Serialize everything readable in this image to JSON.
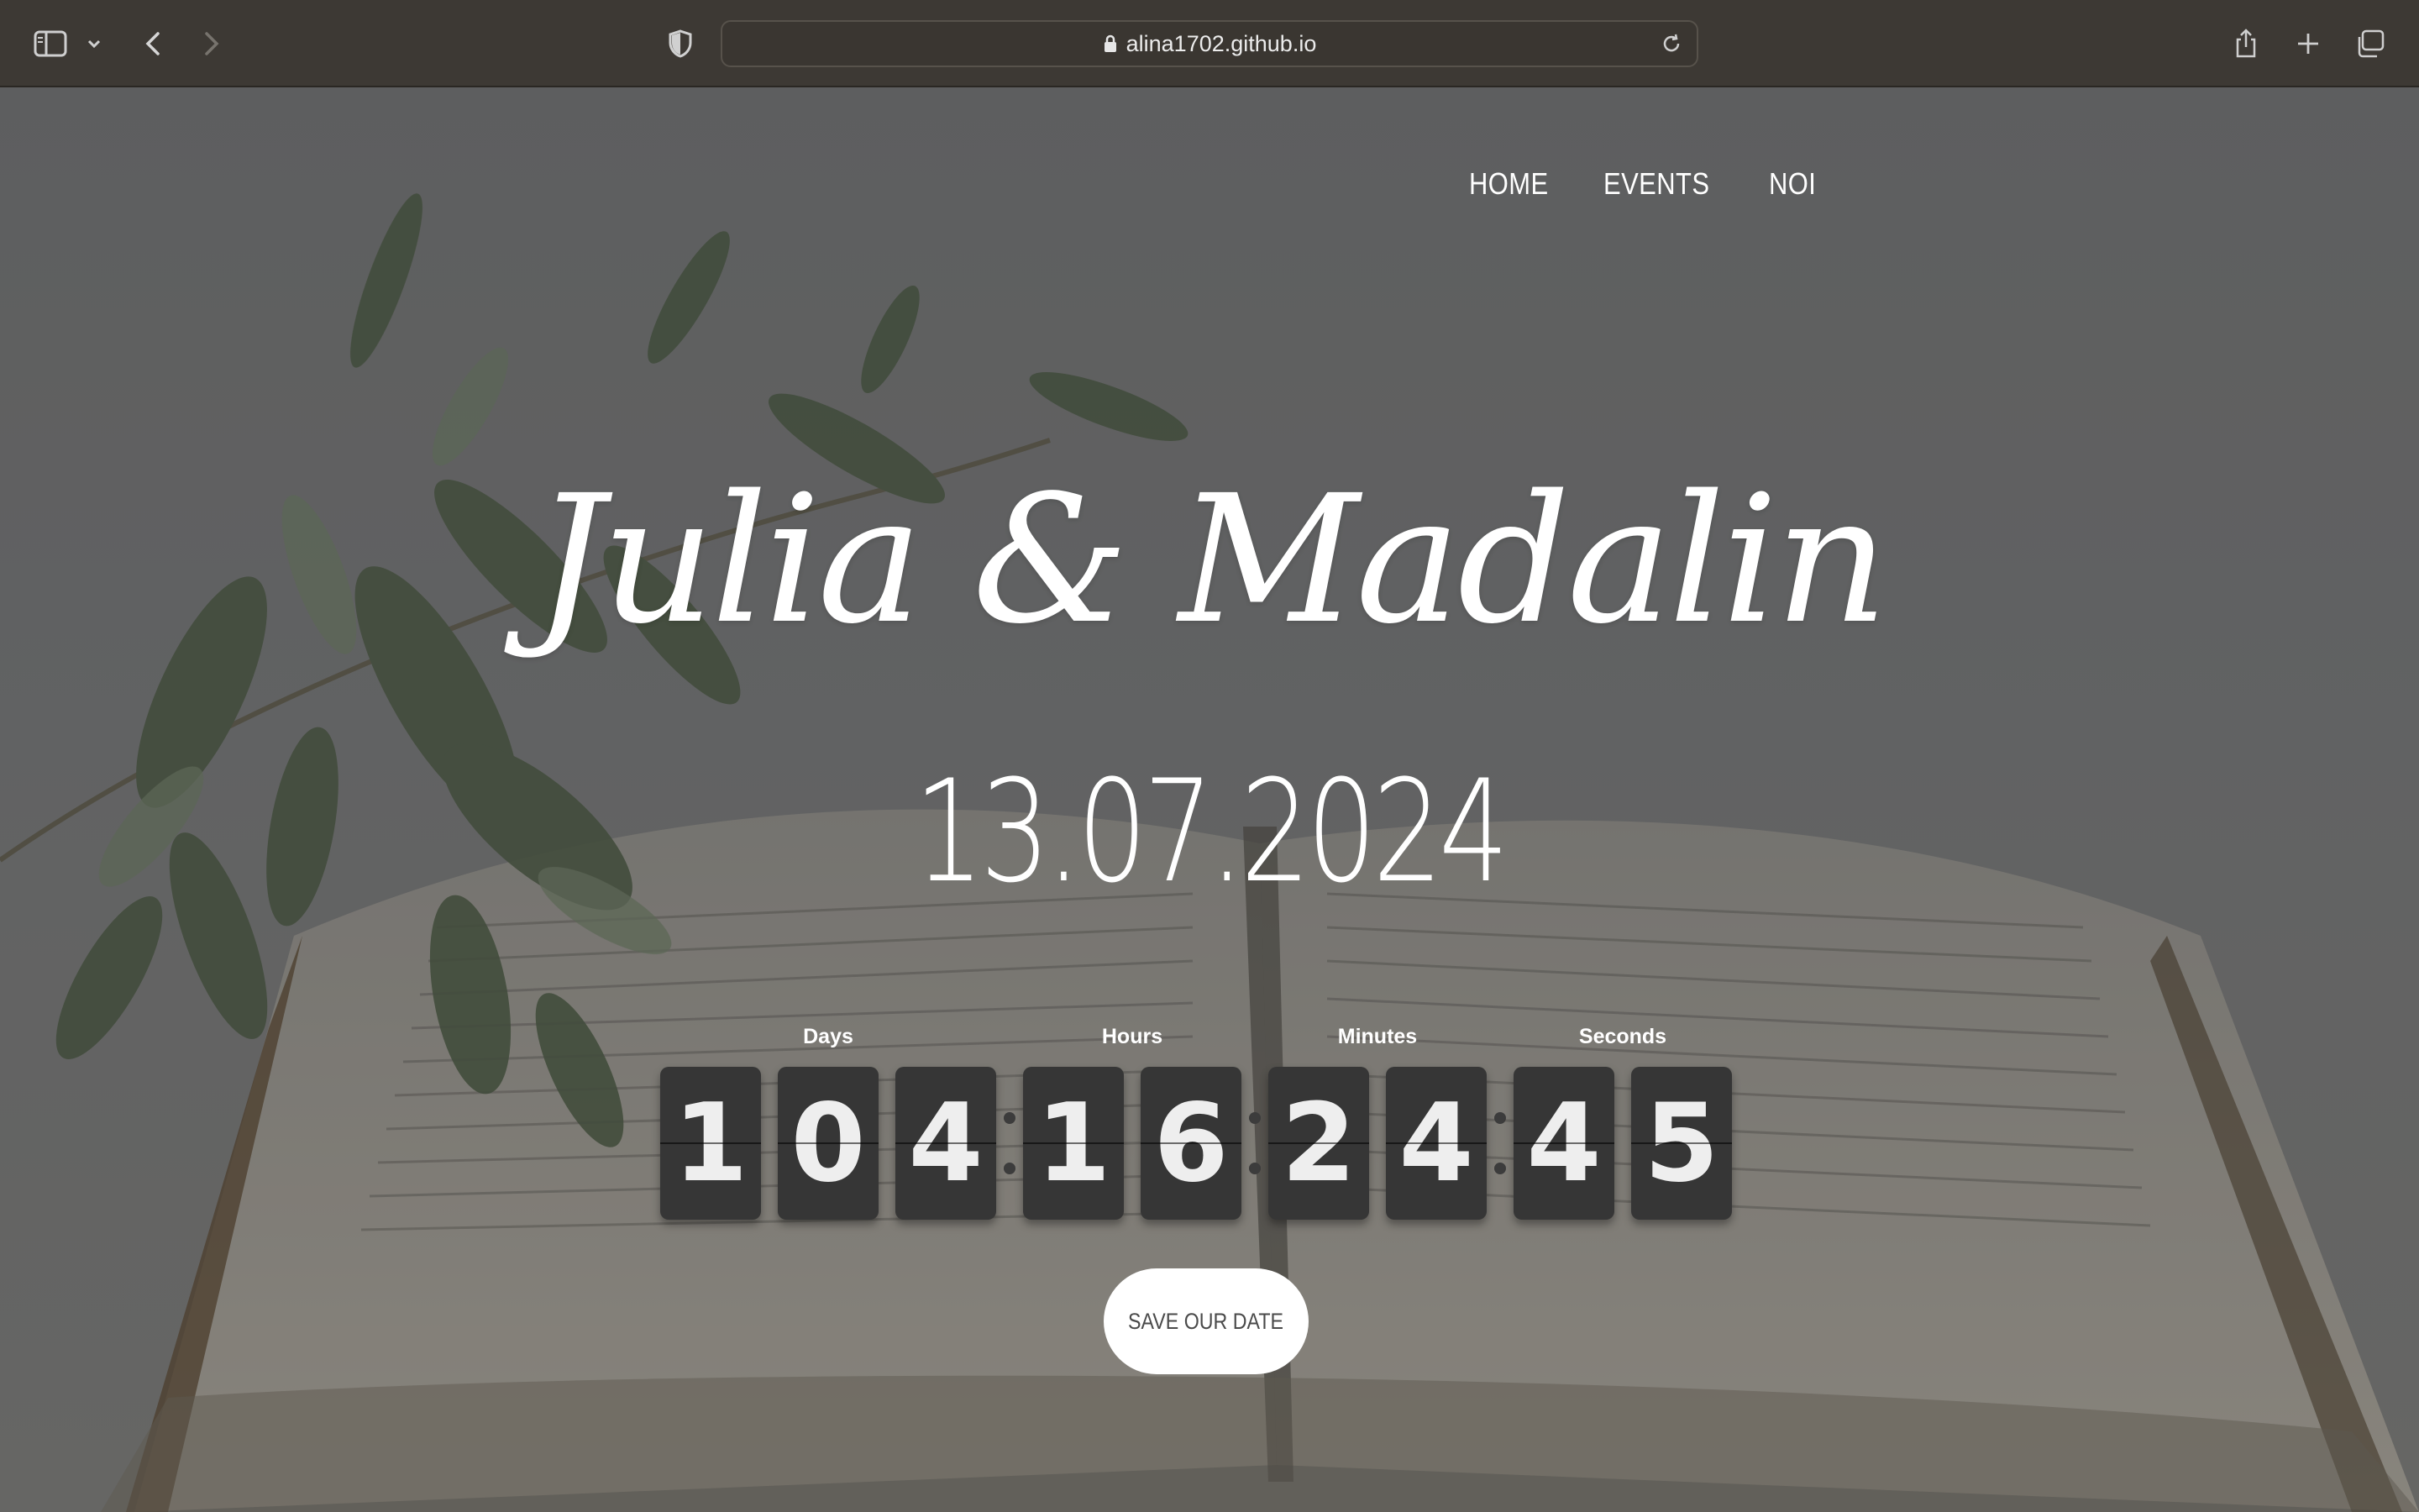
{
  "browser": {
    "url": "alina1702.github.io",
    "icons": [
      "sidebar-icon",
      "chevron-down-icon",
      "back-icon",
      "forward-icon",
      "shield-icon",
      "lock-icon",
      "reload-icon",
      "share-icon",
      "new-tab-icon",
      "tabs-overview-icon"
    ]
  },
  "nav": {
    "items": [
      {
        "label": "HOME"
      },
      {
        "label": "EVENTS"
      },
      {
        "label": "NOI"
      }
    ]
  },
  "hero": {
    "names": "Julia & Madalin",
    "date": "13.07.2024"
  },
  "countdown": {
    "days": {
      "label": "Days",
      "digits": [
        "1",
        "0",
        "4"
      ]
    },
    "hours": {
      "label": "Hours",
      "digits": [
        "1",
        "6"
      ]
    },
    "minutes": {
      "label": "Minutes",
      "digits": [
        "2",
        "4"
      ]
    },
    "seconds": {
      "label": "Seconds",
      "digits": [
        "4",
        "5"
      ]
    }
  },
  "cta": {
    "label": "SAVE OUR DATE"
  },
  "colors": {
    "chrome": "#3d3934",
    "digit_bg": "#363636",
    "text": "#ffffff"
  }
}
